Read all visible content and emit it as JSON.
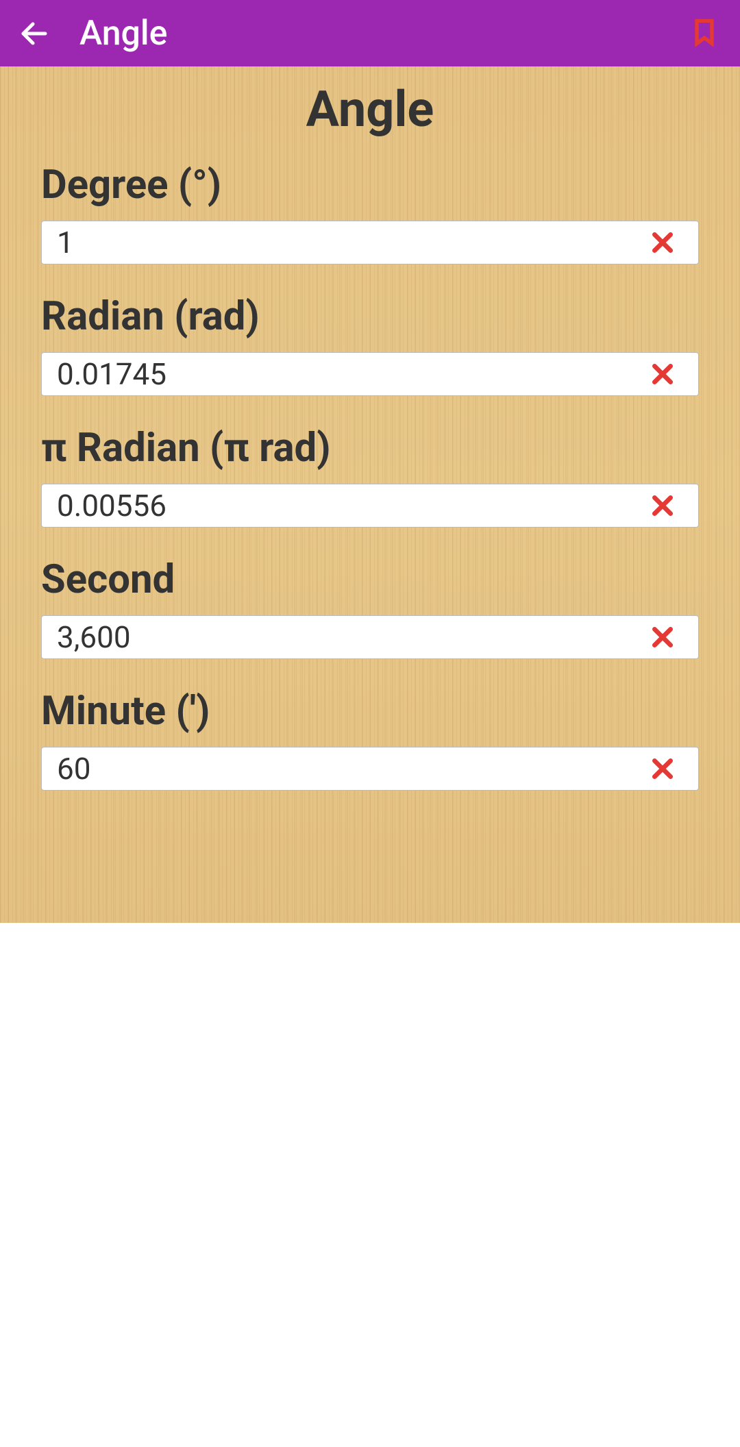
{
  "header": {
    "title": "Angle"
  },
  "page": {
    "title": "Angle"
  },
  "fields": [
    {
      "label": "Degree (°)",
      "value": "1"
    },
    {
      "label": "Radian (rad)",
      "value": "0.01745"
    },
    {
      "label": "π Radian (π rad)",
      "value": "0.00556"
    },
    {
      "label": "Second",
      "value": "3,600"
    },
    {
      "label": "Minute (')",
      "value": "60"
    }
  ]
}
